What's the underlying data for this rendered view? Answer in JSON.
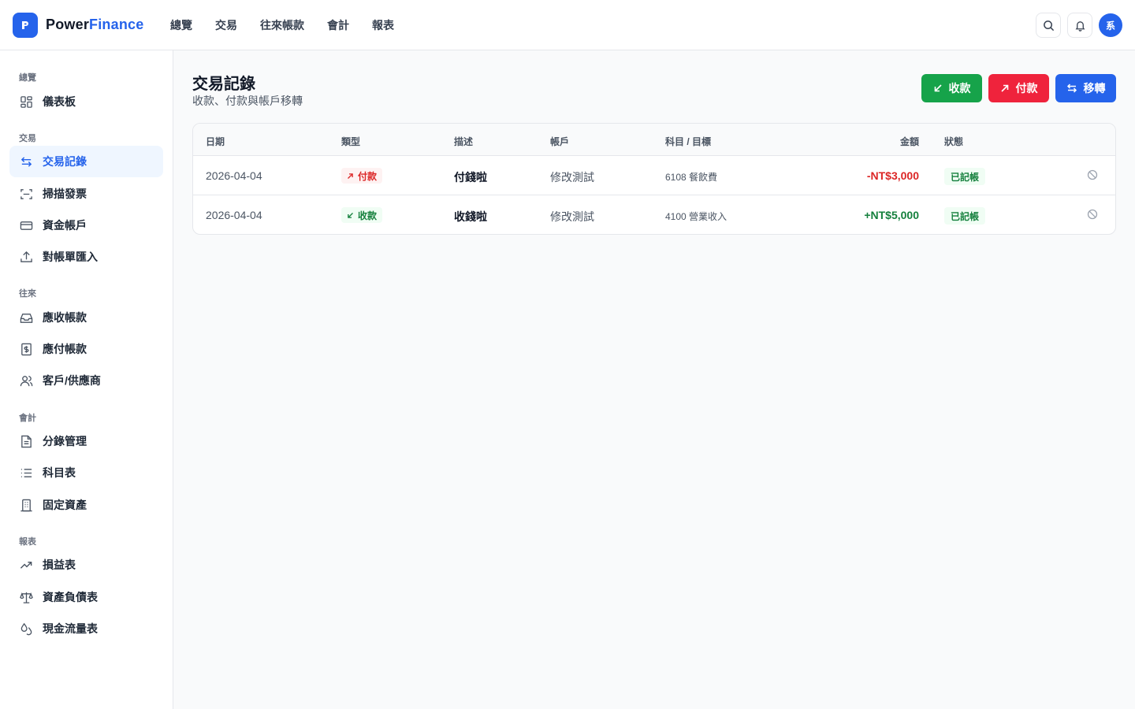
{
  "header": {
    "brand_part1": "Power",
    "brand_part2": "Finance",
    "nav": [
      "總覽",
      "交易",
      "往來帳款",
      "會計",
      "報表"
    ],
    "avatar_text": "系"
  },
  "sidebar": {
    "sections": [
      {
        "label": "總覽",
        "items": [
          {
            "label": "儀表板",
            "icon": "dashboard-icon"
          }
        ]
      },
      {
        "label": "交易",
        "items": [
          {
            "label": "交易記錄",
            "icon": "transfer-arrows-icon",
            "active": true
          },
          {
            "label": "掃描發票",
            "icon": "scan-icon"
          },
          {
            "label": "資金帳戶",
            "icon": "credit-card-icon"
          },
          {
            "label": "對帳單匯入",
            "icon": "upload-icon"
          }
        ]
      },
      {
        "label": "往來",
        "items": [
          {
            "label": "應收帳款",
            "icon": "inbox-icon"
          },
          {
            "label": "應付帳款",
            "icon": "receipt-dollar-icon"
          },
          {
            "label": "客戶/供應商",
            "icon": "users-icon"
          }
        ]
      },
      {
        "label": "會計",
        "items": [
          {
            "label": "分錄管理",
            "icon": "document-icon"
          },
          {
            "label": "科目表",
            "icon": "list-icon"
          },
          {
            "label": "固定資產",
            "icon": "building-icon"
          }
        ]
      },
      {
        "label": "報表",
        "items": [
          {
            "label": "損益表",
            "icon": "trend-up-icon"
          },
          {
            "label": "資產負債表",
            "icon": "scale-icon"
          },
          {
            "label": "現金流量表",
            "icon": "droplets-icon"
          }
        ]
      }
    ]
  },
  "main": {
    "title": "交易記錄",
    "subtitle": "收款、付款與帳戶移轉",
    "actions": {
      "receive": "收款",
      "pay": "付款",
      "transfer": "移轉"
    },
    "table": {
      "headers": [
        "日期",
        "類型",
        "描述",
        "帳戶",
        "科目 / 目標",
        "金額",
        "狀態"
      ],
      "rows": [
        {
          "date": "2026-04-04",
          "type": "付款",
          "desc": "付錢啦",
          "account": "修改測試",
          "subject": "6108 餐飲費",
          "amount": "-NT$3,000",
          "status": "已記帳"
        },
        {
          "date": "2026-04-04",
          "type": "收款",
          "desc": "收錢啦",
          "account": "修改測試",
          "subject": "4100 營業收入",
          "amount": "+NT$5,000",
          "status": "已記帳"
        }
      ]
    }
  },
  "colors": {
    "accent": "#2563eb",
    "receive": "#16a34a",
    "pay": "#ef233c",
    "active_bg": "#eff6ff"
  }
}
